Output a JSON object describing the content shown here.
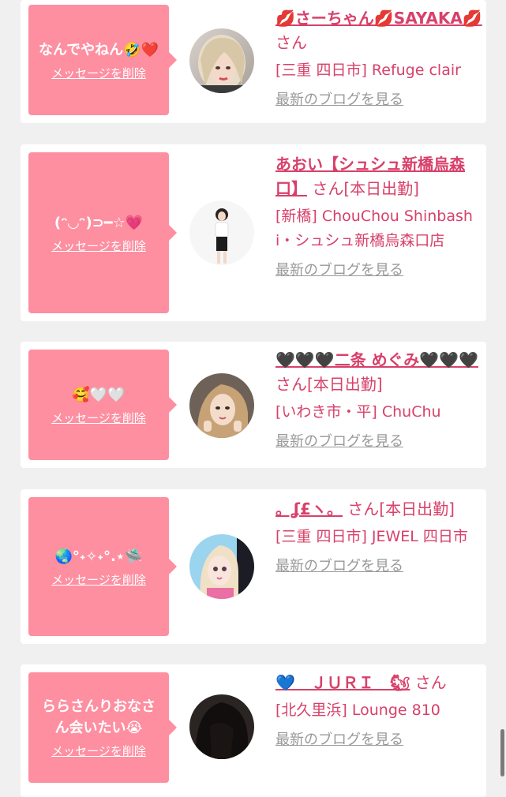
{
  "theme": {
    "bubble_color": "#fd8fa1",
    "name_color": "#d8406a",
    "link_gray": "#999999"
  },
  "messages": [
    {
      "message": "なんでやねん🤣❤️",
      "delete_label": "メッセージを削除",
      "name": "💋さーちゃん💋SAYAKA💋",
      "suffix": "さん",
      "shop": "[三重 四日市] Refuge clair",
      "blog_label": "最新のブログを見る",
      "avatar_icon": "profile-photo"
    },
    {
      "message": "(ᵔ◡ᵔ)⊃━☆💗",
      "delete_label": "メッセージを削除",
      "name": "あおい【シュシュ新橋烏森口】",
      "suffix": "さん[本日出勤]",
      "shop": "[新橋] ChouChou Shinbashi・シュシュ新橋烏森口店",
      "blog_label": "最新のブログを見る",
      "avatar_icon": "profile-photo"
    },
    {
      "message": "🥰🤍🤍",
      "delete_label": "メッセージを削除",
      "name": "🖤🖤🖤二条 めぐみ🖤🖤🖤",
      "suffix": "さん[本日出勤]",
      "shop": "[いわき市・平] ChuChu",
      "blog_label": "最新のブログを見る",
      "avatar_icon": "profile-photo"
    },
    {
      "message": "🌏°˖✧˖°.⋆🛸",
      "delete_label": "メッセージを削除",
      "name": "。ʆ£ヽ。",
      "suffix": "さん[本日出勤]",
      "shop": "[三重 四日市] JEWEL 四日市",
      "blog_label": "最新のブログを見る",
      "avatar_icon": "profile-photo"
    },
    {
      "message": "ららさんりおなさん会いたい😭",
      "delete_label": "メッセージを削除",
      "name": "💙　ＪＵＲＩ　🐿",
      "suffix": "さん",
      "shop": "[北久里浜] Lounge 810",
      "blog_label": "最新のブログを見る",
      "avatar_icon": "profile-photo"
    }
  ]
}
